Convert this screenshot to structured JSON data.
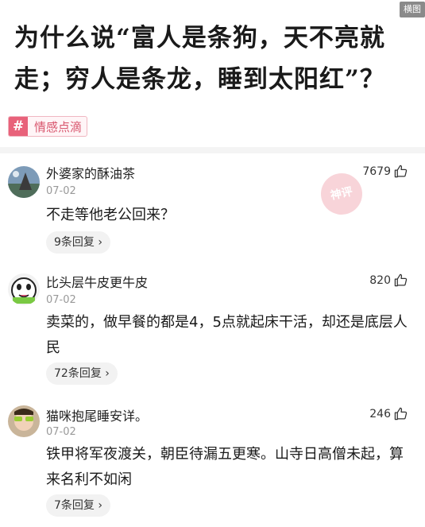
{
  "header": {
    "corner_label": "横图",
    "title": "为什么说“富人是条狗，天不亮就走；穷人是条龙，睡到太阳红”？"
  },
  "topic": {
    "icon": "#",
    "label": "情感点滴"
  },
  "stamp": {
    "text": "神评"
  },
  "comments": [
    {
      "user": "外婆家的酥油茶",
      "date": "07-02",
      "likes": "7679",
      "content": "不走等他老公回来？",
      "replies": "9条回复",
      "avatar": "landscape-avatar"
    },
    {
      "user": "比头层牛皮更牛皮",
      "date": "07-02",
      "likes": "820",
      "content": "卖菜的，做早餐的都是4，5点就起床干活，却还是底层人民",
      "replies": "72条回复",
      "avatar": "cartoon-face-avatar"
    },
    {
      "user": "猫咪抱尾睡安详。",
      "date": "07-02",
      "likes": "246",
      "content": "铁甲将军夜渡关，朝臣待漏五更寒。山寺日高僧未起，算来名利不如闲",
      "replies": "7条回复",
      "avatar": "person-avatar"
    }
  ],
  "colors": {
    "accent": "#e8627a",
    "muted": "#999999"
  }
}
